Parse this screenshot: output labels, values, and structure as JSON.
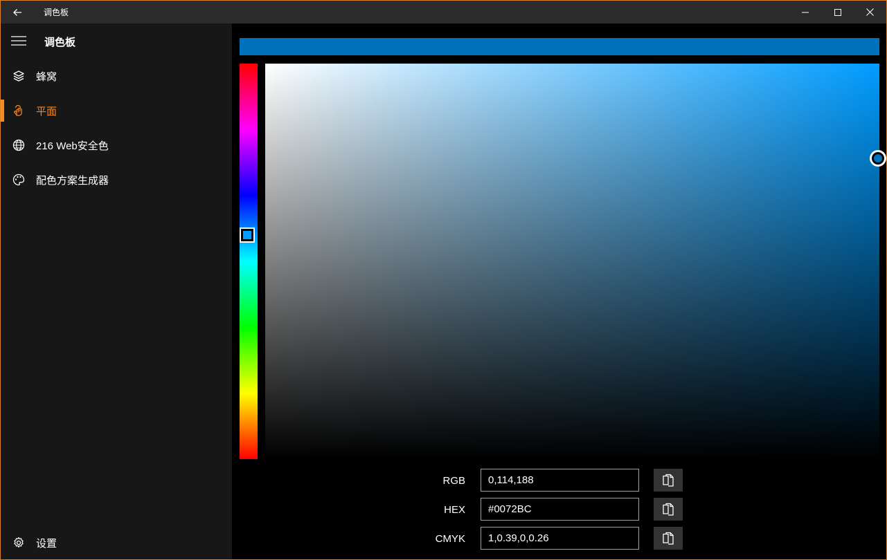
{
  "window": {
    "title": "调色板",
    "frame_color": "#d9832d"
  },
  "sidebar": {
    "title": "调色板",
    "accent_color": "#f7891d",
    "items": [
      {
        "label": "蜂窝",
        "icon": "layers-icon"
      },
      {
        "label": "平面",
        "icon": "touch-hand-icon",
        "active": true
      },
      {
        "label": "216 Web安全色",
        "icon": "globe-icon"
      },
      {
        "label": "配色方案生成器",
        "icon": "palette-icon"
      }
    ],
    "settings_label": "设置"
  },
  "picker": {
    "selected_color": "#0072BC",
    "hue_color": "#009CFF",
    "rows": [
      {
        "label": "RGB",
        "value": "0,114,188"
      },
      {
        "label": "HEX",
        "value": "#0072BC"
      },
      {
        "label": "CMYK",
        "value": "1,0.39,0,0.26"
      }
    ]
  }
}
